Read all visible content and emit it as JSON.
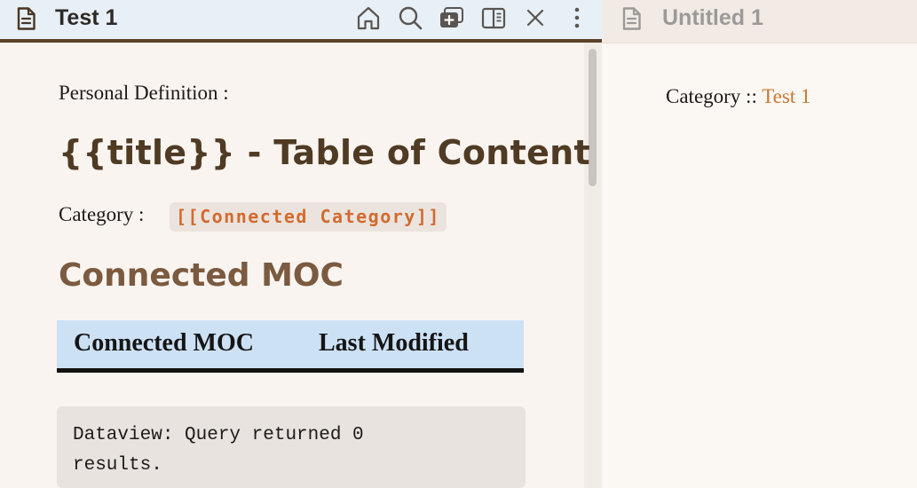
{
  "left_tab": {
    "title": "Test 1",
    "icon": "document-icon",
    "actions": [
      "home-icon",
      "search-icon",
      "new-tab-icon",
      "split-view-icon",
      "close-icon",
      "more-vertical-icon"
    ]
  },
  "document": {
    "personal_definition": "Personal Definition :",
    "toc_heading": "{{title}} - Table of Content",
    "category_label": "Category :",
    "category_link": "[[Connected Category]]",
    "moc_heading": "Connected MOC",
    "table": {
      "columns": [
        "Connected MOC",
        "Last Modified"
      ]
    },
    "dataview_message": "Dataview: Query returned 0 results."
  },
  "right_tab": {
    "title": "Untitled 1",
    "icon": "document-icon",
    "category_label": "Category ::",
    "category_link": "Test 1"
  },
  "colors": {
    "header_bg": "#e7f0f7",
    "header_border": "#5c4128",
    "heading": "#4f3a23",
    "moc_heading": "#7b5a3f",
    "code_text": "#d36a2f",
    "link": "#c9772f",
    "table_header_bg": "#cde1f5"
  }
}
